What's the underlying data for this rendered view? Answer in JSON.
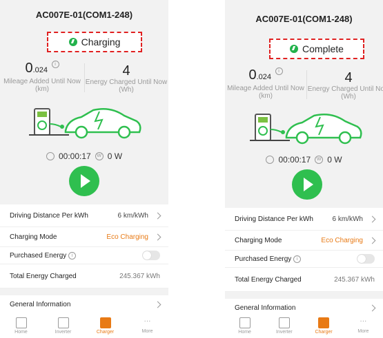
{
  "device": {
    "title": "AC007E-01(COM1-248)"
  },
  "screens": [
    {
      "status_label": "Charging",
      "mileage": {
        "value_main": "0",
        "value_decimal": ".024",
        "label": "Mileage Added Until Now (km)"
      },
      "energy": {
        "value": "4",
        "label": "Energy Charged Until Now (Wh)"
      },
      "timer": "00:00:17",
      "power": "0 W",
      "settings": {
        "driving_distance_label": "Driving Distance Per kWh",
        "driving_distance_value": "6 km/kWh",
        "charging_mode_label": "Charging Mode",
        "charging_mode_value": "Eco Charging",
        "purchased_energy_label": "Purchased Energy",
        "total_energy_label": "Total Energy Charged",
        "total_energy_value": "245.367 kWh",
        "general_info_label": "General Information"
      }
    },
    {
      "status_label": "Complete",
      "mileage": {
        "value_main": "0",
        "value_decimal": ".024",
        "label": "Mileage Added Until Now (km)"
      },
      "energy": {
        "value": "4",
        "label": "Energy Charged Until Now (Wh)"
      },
      "timer": "00:00:17",
      "power": "0 W",
      "settings": {
        "driving_distance_label": "Driving Distance Per kWh",
        "driving_distance_value": "6 km/kWh",
        "charging_mode_label": "Charging Mode",
        "charging_mode_value": "Eco Charging",
        "purchased_energy_label": "Purchased Energy",
        "total_energy_label": "Total Energy Charged",
        "total_energy_value": "245.367 kWh",
        "general_info_label": "General Information"
      }
    }
  ],
  "tabs": [
    {
      "label": "Home",
      "icon": "home-icon"
    },
    {
      "label": "Inverter",
      "icon": "inverter-icon"
    },
    {
      "label": "Charger",
      "icon": "charger-icon",
      "active": true
    },
    {
      "label": "More",
      "icon": "more-icon"
    }
  ],
  "colors": {
    "accent": "#e87a15",
    "green": "#2fbf4f",
    "dashed_border": "#e02020"
  }
}
